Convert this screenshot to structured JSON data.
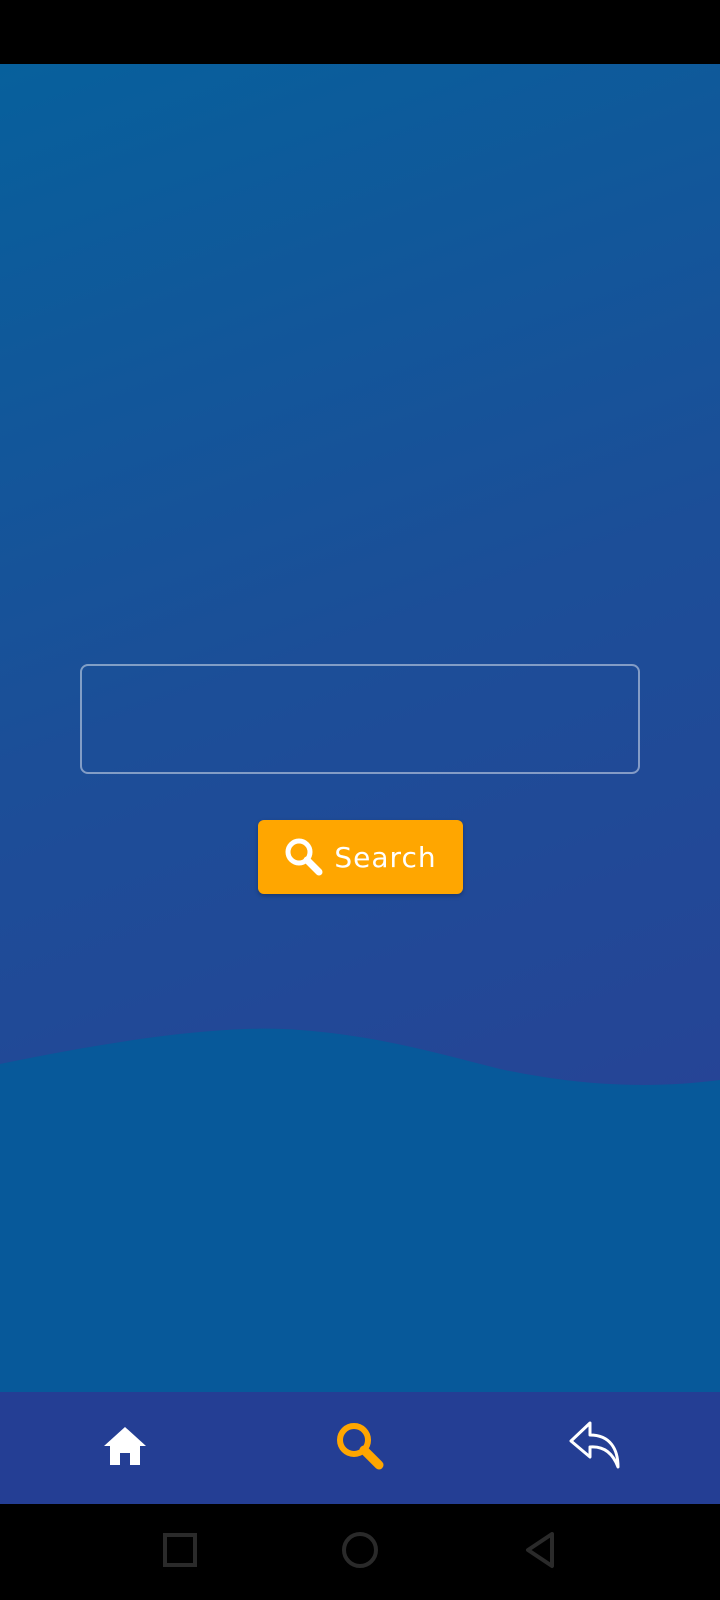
{
  "search": {
    "input_value": "",
    "input_placeholder": "",
    "button_label": "Search"
  },
  "bottom_nav": {
    "items": [
      {
        "name": "home",
        "icon": "home-icon",
        "active": false
      },
      {
        "name": "search",
        "icon": "search-icon",
        "active": true
      },
      {
        "name": "back",
        "icon": "reply-arrow-icon",
        "active": false
      }
    ]
  },
  "colors": {
    "accent": "#ffa600",
    "nav_background": "#243e94",
    "content_gradient_start": "#07609c",
    "content_gradient_end": "#2b3f95",
    "wave": "#07599a",
    "icon_inactive": "#ffffff"
  },
  "system_nav": {
    "items": [
      "recent-apps-icon",
      "home-circle-icon",
      "back-triangle-icon"
    ]
  }
}
